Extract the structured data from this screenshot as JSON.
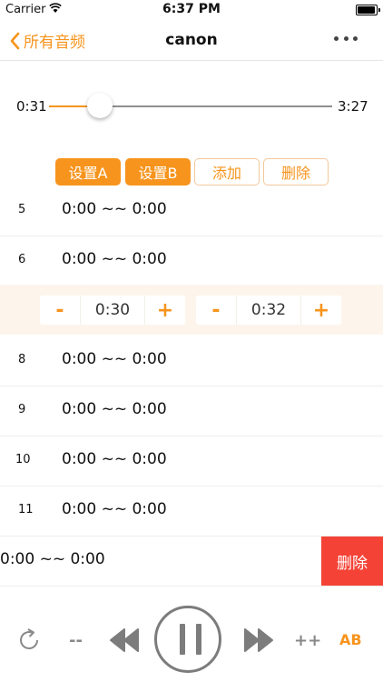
{
  "status_bar": {
    "carrier": "Carrier",
    "time": "6:37 PM"
  },
  "nav": {
    "back_label": "所有音频",
    "title": "canon"
  },
  "progress": {
    "current": "0:31",
    "total": "3:27",
    "fraction": 0.18
  },
  "ab_buttons": {
    "set_a": "设置A",
    "set_b": "设置B",
    "add": "添加",
    "delete": "删除"
  },
  "segments": [
    {
      "index": "5",
      "range": "0:00 ~~ 0:00"
    },
    {
      "index": "6",
      "range": "0:00 ~~ 0:00"
    },
    {
      "index": "8",
      "range": "0:00 ~~ 0:00"
    },
    {
      "index": "9",
      "range": "0:00 ~~ 0:00"
    },
    {
      "index": "10",
      "range": "0:00 ~~ 0:00"
    },
    {
      "index": "11",
      "range": "0:00 ~~ 0:00"
    }
  ],
  "editor": {
    "start": {
      "minus": "-",
      "value": "0:30",
      "plus": "+"
    },
    "end": {
      "minus": "-",
      "value": "0:32",
      "plus": "+"
    }
  },
  "swiped_row": {
    "range": "0:00 ~~ 0:00",
    "delete_label": "删除"
  },
  "player": {
    "rewind_step": "--",
    "forward_step": "++",
    "ab_label": "AB"
  },
  "colors": {
    "accent": "#f7941d",
    "delete": "#f44336",
    "control": "#7c7c7c"
  }
}
